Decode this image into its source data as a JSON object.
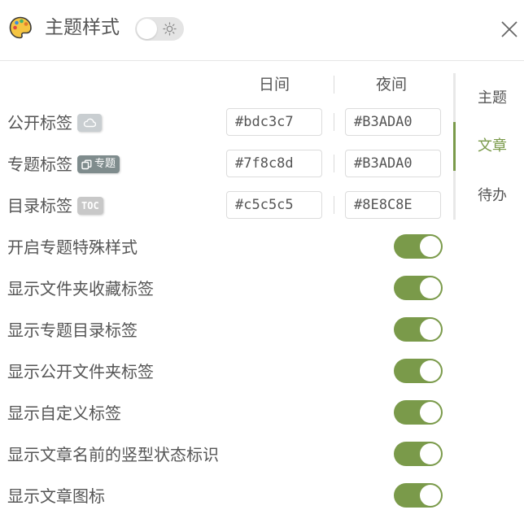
{
  "header": {
    "title": "主题样式"
  },
  "nav": {
    "items": [
      {
        "label": "主题"
      },
      {
        "label": "文章"
      },
      {
        "label": "待办"
      }
    ],
    "active_index": 1
  },
  "columns": {
    "day": "日间",
    "night": "夜间"
  },
  "tags": [
    {
      "label": "公开标签",
      "badge_icon": "cloud-icon",
      "day": "#bdc3c7",
      "night": "#B3ADA0"
    },
    {
      "label": "专题标签",
      "badge_text": "专题",
      "badge_icon": "copy-icon",
      "day": "#7f8c8d",
      "night": "#B3ADA0"
    },
    {
      "label": "目录标签",
      "badge_text": "TOC",
      "day": "#c5c5c5",
      "night": "#8E8C8E"
    }
  ],
  "toggles": [
    {
      "label": "开启专题特殊样式",
      "on": true
    },
    {
      "label": "显示文件夹收藏标签",
      "on": true
    },
    {
      "label": "显示专题目录标签",
      "on": true
    },
    {
      "label": "显示公开文件夹标签",
      "on": true
    },
    {
      "label": "显示自定义标签",
      "on": true
    },
    {
      "label": "显示文章名前的竖型状态标识",
      "on": true
    },
    {
      "label": "显示文章图标",
      "on": true
    }
  ],
  "colors": {
    "accent": "#7a9a4a",
    "text": "#555555"
  }
}
